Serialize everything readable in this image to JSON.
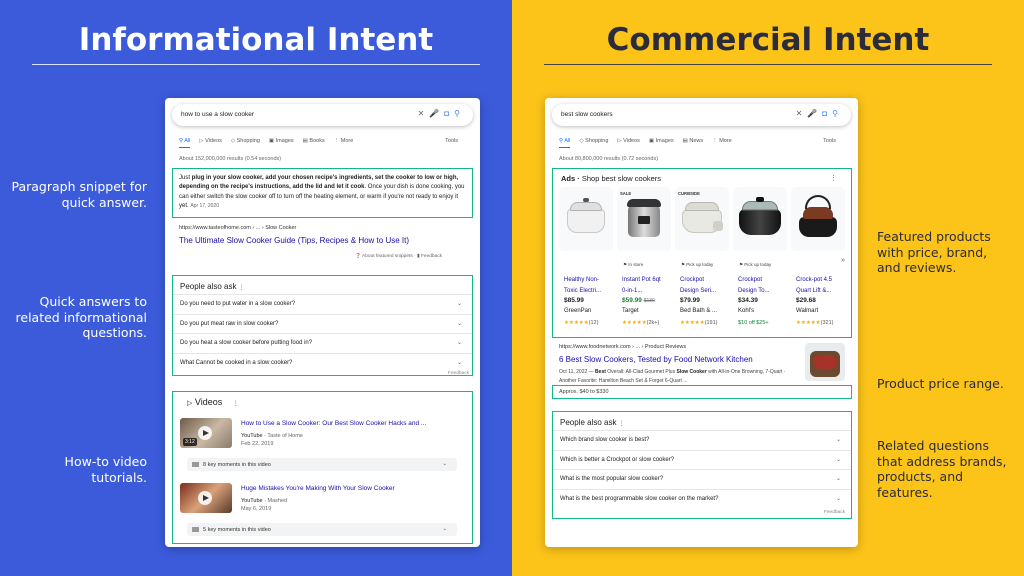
{
  "colors": {
    "left_bg": "#3b5bdb",
    "right_bg": "#fcc419",
    "highlight": "#12b886",
    "link": "#1a0dab"
  },
  "left": {
    "title": "Informational Intent",
    "annotations": [
      "Paragraph snippet for quick answer.",
      "Quick answers to related informational questions.",
      "How-to video tutorials."
    ],
    "serp": {
      "query": "how to use a slow cooker",
      "tabs": [
        "All",
        "Videos",
        "Shopping",
        "Images",
        "Books",
        "⋮ More"
      ],
      "tools": "Tools",
      "stats": "About 152,000,000 results (0.54 seconds)",
      "snippet": {
        "pre": "Just ",
        "bold": "plug in your slow cooker, add your chosen recipe's ingredients, set the cooker to low or high, depending on the recipe's instructions, add the lid and let it cook",
        "post": ". Once your dish is done cooking, you can either switch the slow cooker off to turn off the heating element, or warm if you're not ready to enjoy it yet.",
        "date": "Apr 17, 2020"
      },
      "result_url": "https://www.tasteofhome.com › ... › Slow Cooker",
      "result_title": "The Ultimate Slow Cooker Guide (Tips, Recipes & How to Use It)",
      "about_snippets": "About featured snippets",
      "feedback": "Feedback",
      "paa_title": "People also ask",
      "paa": [
        "Do you need to put water in a slow cooker?",
        "Do you put meat raw in slow cooker?",
        "Do you heat a slow cooker before putting food in?",
        "What Cannot be cooked in a slow cooker?"
      ],
      "videos_title": "Videos",
      "videos": [
        {
          "title": "How to Use a Slow Cooker: Our Best Slow Cooker Hacks and ...",
          "source": "YouTube",
          "channel": "Taste of Home",
          "date": "Feb 22, 2019",
          "duration": "3:12",
          "moments": "8 key moments in this video"
        },
        {
          "title": "Huge Mistakes You're Making With Your Slow Cooker",
          "source": "YouTube",
          "channel": "Mashed",
          "date": "May 6, 2019",
          "duration": "",
          "moments": "5 key moments in this video"
        }
      ]
    }
  },
  "right": {
    "title": "Commercial Intent",
    "annotations": [
      "Featured products with price, brand, and reviews.",
      "Product price range.",
      "Related questions that address brands, products, and features."
    ],
    "serp": {
      "query": "best slow cookers",
      "tabs": [
        "All",
        "Shopping",
        "Videos",
        "Images",
        "News",
        "⋮ More"
      ],
      "tools": "Tools",
      "stats": "About 80,800,000 results (0.72 seconds)",
      "ads_label": "Ads ·",
      "ads_title": "Shop best slow cookers",
      "products": [
        {
          "badge": "",
          "pickup": "",
          "name1": "Healthy Non-",
          "name2": "Toxic Electri...",
          "price": "$85.99",
          "old": "",
          "store": "GreenPan",
          "stars": "★★★★★",
          "reviews": "(12)",
          "icon": "slow-cooker-white-icon"
        },
        {
          "badge": "SALE",
          "pickup": "In store",
          "name1": "Instant Pot 6qt",
          "name2": "0-in-1...",
          "price": "$59.99",
          "old": "$130",
          "store": "Target",
          "stars": "★★★★★",
          "reviews": "(2k+)",
          "icon": "instant-pot-icon"
        },
        {
          "badge": "CURBSIDE",
          "pickup": "Pick up today",
          "name1": "Crockpot",
          "name2": "Design Seri...",
          "price": "$79.99",
          "old": "",
          "store": "Bed Bath & ...",
          "stars": "★★★★★",
          "reviews": "(191)",
          "icon": "crockpot-white-icon"
        },
        {
          "badge": "",
          "pickup": "Pick up today",
          "name1": "Crockpot",
          "name2": "Design To...",
          "price": "$34.39",
          "old": "",
          "store": "Kohl's",
          "stars": "$10 off $25+",
          "reviews": "",
          "icon": "crockpot-black-icon"
        },
        {
          "badge": "",
          "pickup": "",
          "name1": "Crock-pot 4.5",
          "name2": "Quart Lift &...",
          "price": "$29.68",
          "old": "",
          "store": "Walmart",
          "stars": "★★★★★",
          "reviews": "(321)",
          "icon": "crockpot-lift-icon"
        }
      ],
      "result_url": "https://www.foodnetwork.com › ... › Product Reviews",
      "result_title": "6 Best Slow Cookers, Tested by Food Network Kitchen",
      "result_desc_date": "Oct 11, 2022 — ",
      "result_desc_b1": "Best",
      "result_desc_1": " Overall: All-Clad Gourmet Plus ",
      "result_desc_b2": "Slow Cooker",
      "result_desc_2": " with All-in-One Browning, 7-Quart · Another Favorite: Hamilton Beach Set & Forget 6-Quart ...",
      "price_range": "Approx. $40 to $330",
      "paa_title": "People also ask",
      "paa": [
        "Which brand slow cooker is best?",
        "Which is better a Crockpot or slow cooker?",
        "What is the most popular slow cooker?",
        "What is the best programmable slow cooker on the market?"
      ],
      "feedback": "Feedback"
    }
  }
}
